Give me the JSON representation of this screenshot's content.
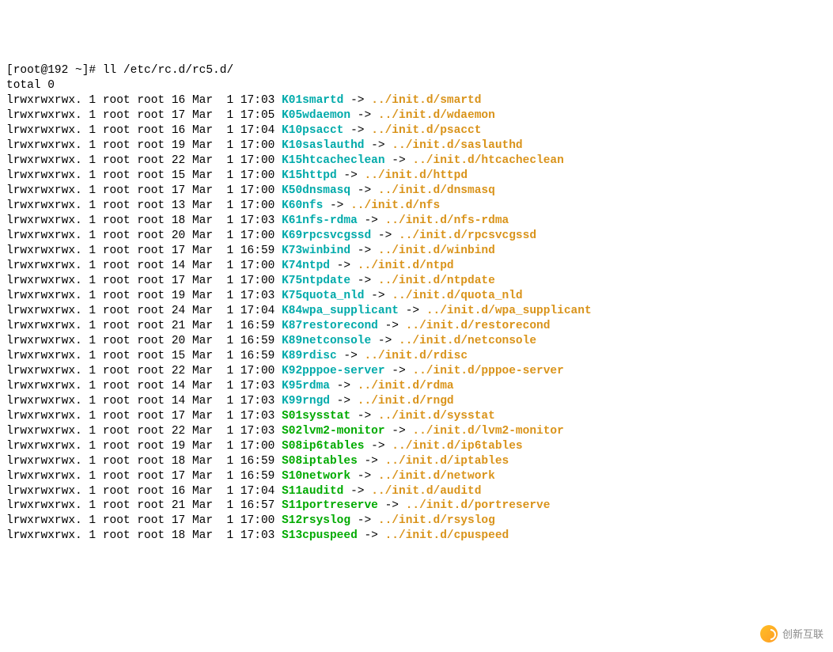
{
  "prompt": "[root@192 ~]# ",
  "command": "ll /etc/rc.d/rc5.d/",
  "total_line": "total 0",
  "arrow": " -> ",
  "entries": [
    {
      "perms": "lrwxrwxrwx. 1 root root 16 Mar  1 17:03 ",
      "link": "K01smartd",
      "target": "../init.d/smartd",
      "type": "K"
    },
    {
      "perms": "lrwxrwxrwx. 1 root root 17 Mar  1 17:05 ",
      "link": "K05wdaemon",
      "target": "../init.d/wdaemon",
      "type": "K"
    },
    {
      "perms": "lrwxrwxrwx. 1 root root 16 Mar  1 17:04 ",
      "link": "K10psacct",
      "target": "../init.d/psacct",
      "type": "K"
    },
    {
      "perms": "lrwxrwxrwx. 1 root root 19 Mar  1 17:00 ",
      "link": "K10saslauthd",
      "target": "../init.d/saslauthd",
      "type": "K"
    },
    {
      "perms": "lrwxrwxrwx. 1 root root 22 Mar  1 17:00 ",
      "link": "K15htcacheclean",
      "target": "../init.d/htcacheclean",
      "type": "K"
    },
    {
      "perms": "lrwxrwxrwx. 1 root root 15 Mar  1 17:00 ",
      "link": "K15httpd",
      "target": "../init.d/httpd",
      "type": "K"
    },
    {
      "perms": "lrwxrwxrwx. 1 root root 17 Mar  1 17:00 ",
      "link": "K50dnsmasq",
      "target": "../init.d/dnsmasq",
      "type": "K"
    },
    {
      "perms": "lrwxrwxrwx. 1 root root 13 Mar  1 17:00 ",
      "link": "K60nfs",
      "target": "../init.d/nfs",
      "type": "K"
    },
    {
      "perms": "lrwxrwxrwx. 1 root root 18 Mar  1 17:03 ",
      "link": "K61nfs-rdma",
      "target": "../init.d/nfs-rdma",
      "type": "K"
    },
    {
      "perms": "lrwxrwxrwx. 1 root root 20 Mar  1 17:00 ",
      "link": "K69rpcsvcgssd",
      "target": "../init.d/rpcsvcgssd",
      "type": "K"
    },
    {
      "perms": "lrwxrwxrwx. 1 root root 17 Mar  1 16:59 ",
      "link": "K73winbind",
      "target": "../init.d/winbind",
      "type": "K"
    },
    {
      "perms": "lrwxrwxrwx. 1 root root 14 Mar  1 17:00 ",
      "link": "K74ntpd",
      "target": "../init.d/ntpd",
      "type": "K"
    },
    {
      "perms": "lrwxrwxrwx. 1 root root 17 Mar  1 17:00 ",
      "link": "K75ntpdate",
      "target": "../init.d/ntpdate",
      "type": "K"
    },
    {
      "perms": "lrwxrwxrwx. 1 root root 19 Mar  1 17:03 ",
      "link": "K75quota_nld",
      "target": "../init.d/quota_nld",
      "type": "K"
    },
    {
      "perms": "lrwxrwxrwx. 1 root root 24 Mar  1 17:04 ",
      "link": "K84wpa_supplicant",
      "target": "../init.d/wpa_supplicant",
      "type": "K"
    },
    {
      "perms": "lrwxrwxrwx. 1 root root 21 Mar  1 16:59 ",
      "link": "K87restorecond",
      "target": "../init.d/restorecond",
      "type": "K"
    },
    {
      "perms": "lrwxrwxrwx. 1 root root 20 Mar  1 16:59 ",
      "link": "K89netconsole",
      "target": "../init.d/netconsole",
      "type": "K"
    },
    {
      "perms": "lrwxrwxrwx. 1 root root 15 Mar  1 16:59 ",
      "link": "K89rdisc",
      "target": "../init.d/rdisc",
      "type": "K"
    },
    {
      "perms": "lrwxrwxrwx. 1 root root 22 Mar  1 17:00 ",
      "link": "K92pppoe-server",
      "target": "../init.d/pppoe-server",
      "type": "K"
    },
    {
      "perms": "lrwxrwxrwx. 1 root root 14 Mar  1 17:03 ",
      "link": "K95rdma",
      "target": "../init.d/rdma",
      "type": "K"
    },
    {
      "perms": "lrwxrwxrwx. 1 root root 14 Mar  1 17:03 ",
      "link": "K99rngd",
      "target": "../init.d/rngd",
      "type": "K"
    },
    {
      "perms": "lrwxrwxrwx. 1 root root 17 Mar  1 17:03 ",
      "link": "S01sysstat",
      "target": "../init.d/sysstat",
      "type": "S"
    },
    {
      "perms": "lrwxrwxrwx. 1 root root 22 Mar  1 17:03 ",
      "link": "S02lvm2-monitor",
      "target": "../init.d/lvm2-monitor",
      "type": "S"
    },
    {
      "perms": "lrwxrwxrwx. 1 root root 19 Mar  1 17:00 ",
      "link": "S08ip6tables",
      "target": "../init.d/ip6tables",
      "type": "S"
    },
    {
      "perms": "lrwxrwxrwx. 1 root root 18 Mar  1 16:59 ",
      "link": "S08iptables",
      "target": "../init.d/iptables",
      "type": "S"
    },
    {
      "perms": "lrwxrwxrwx. 1 root root 17 Mar  1 16:59 ",
      "link": "S10network",
      "target": "../init.d/network",
      "type": "S"
    },
    {
      "perms": "lrwxrwxrwx. 1 root root 16 Mar  1 17:04 ",
      "link": "S11auditd",
      "target": "../init.d/auditd",
      "type": "S"
    },
    {
      "perms": "lrwxrwxrwx. 1 root root 21 Mar  1 16:57 ",
      "link": "S11portreserve",
      "target": "../init.d/portreserve",
      "type": "S"
    },
    {
      "perms": "lrwxrwxrwx. 1 root root 17 Mar  1 17:00 ",
      "link": "S12rsyslog",
      "target": "../init.d/rsyslog",
      "type": "S"
    },
    {
      "perms": "lrwxrwxrwx. 1 root root 18 Mar  1 17:03 ",
      "link": "S13cpuspeed",
      "target": "../init.d/cpuspeed",
      "type": "S"
    }
  ],
  "watermark": "创新互联"
}
